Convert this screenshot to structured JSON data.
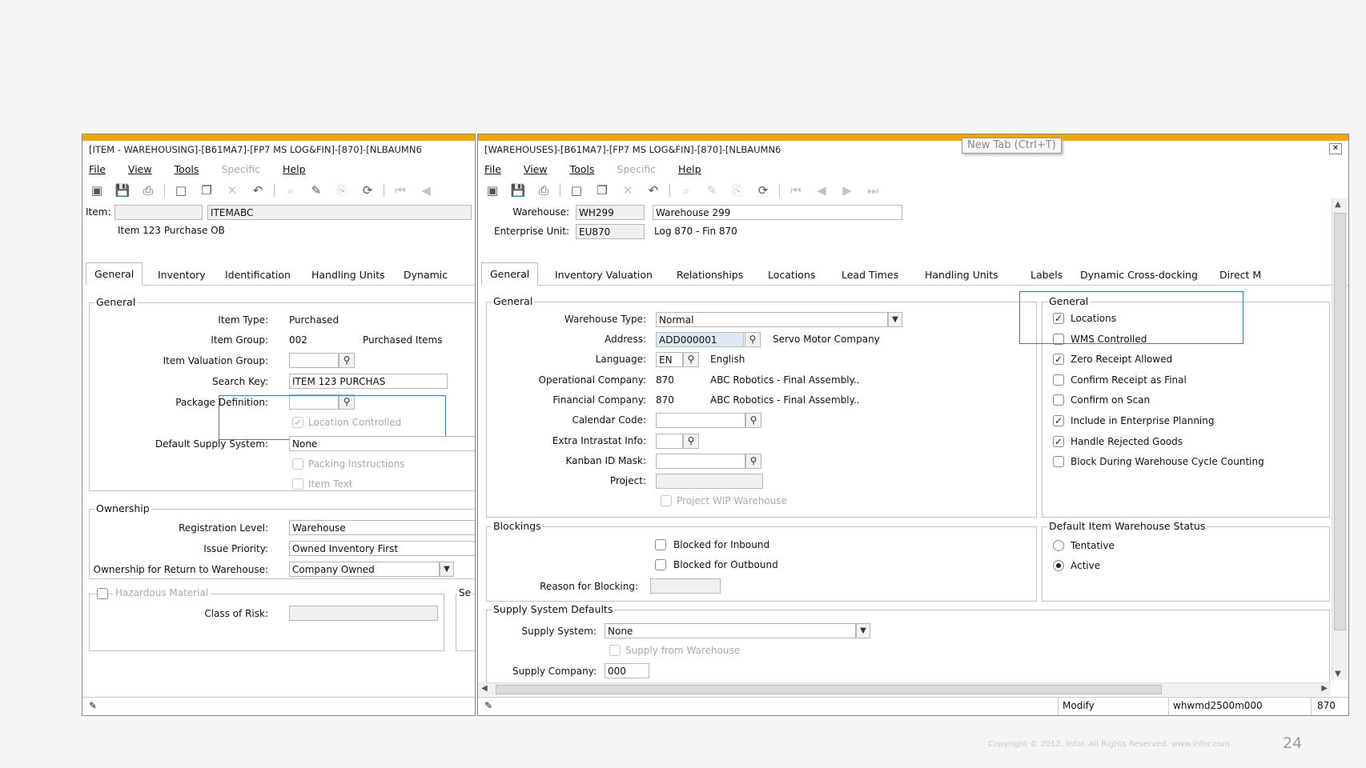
{
  "left": {
    "title": "[ITEM - WAREHOUSING]-[B61MA7]-[FP7 MS LOG&FIN]-[870]-[NLBAUMN6",
    "menu": [
      "File",
      "View",
      "Tools",
      "Specific",
      "Help"
    ],
    "header": {
      "item_label": "Item:",
      "item_code": "ITEMABC",
      "item_desc": "Item 123 Purchase OB"
    },
    "tabs": [
      "General",
      "Inventory",
      "Identification",
      "Handling Units",
      "Dynamic"
    ],
    "general": {
      "title": "General",
      "item_type_label": "Item Type:",
      "item_type": "Purchased",
      "item_group_label": "Item Group:",
      "item_group": "002",
      "item_group_desc": "Purchased Items",
      "valuation_label": "Item Valuation Group:",
      "valuation_value": "",
      "search_key_label": "Search Key:",
      "search_key": "ITEM 123 PURCHAS",
      "package_label": "Package Definition:",
      "package_value": "",
      "location_controlled": "Location Controlled",
      "supply_label": "Default Supply System:",
      "supply_value": "None",
      "packing": "Packing Instructions",
      "item_text": "Item Text"
    },
    "ownership": {
      "title": "Ownership",
      "reg_label": "Registration Level:",
      "reg_value": "Warehouse",
      "issue_label": "Issue Priority:",
      "issue_value": "Owned Inventory First",
      "return_label": "Ownership for Return to Warehouse:",
      "return_value": "Company Owned"
    },
    "hazard": {
      "label": "Hazardous Material",
      "class_label": "Class of Risk:",
      "class_value": "",
      "se": "Se"
    }
  },
  "right": {
    "title": "[WAREHOUSES]-[B61MA7]-[FP7 MS LOG&FIN]-[870]-[NLBAUMN6",
    "tooltip": "New Tab (Ctrl+T)",
    "menu": [
      "File",
      "View",
      "Tools",
      "Specific",
      "Help"
    ],
    "header": {
      "wh_label": "Warehouse:",
      "wh_code": "WH299",
      "wh_desc": "Warehouse 299",
      "eu_label": "Enterprise Unit:",
      "eu_code": "EU870",
      "eu_desc": "Log 870 - Fin 870"
    },
    "tabs": [
      "General",
      "Inventory Valuation",
      "Relationships",
      "Locations",
      "Lead Times",
      "Handling Units",
      "Labels",
      "Dynamic Cross-docking",
      "Direct M"
    ],
    "general": {
      "title": "General",
      "wt_label": "Warehouse Type:",
      "wt_value": "Normal",
      "addr_label": "Address:",
      "addr_value": "ADD000001",
      "addr_desc": "Servo Motor Company",
      "lang_label": "Language:",
      "lang_value": "EN",
      "lang_desc": "English",
      "opco_label": "Operational Company:",
      "opco_value": "870",
      "opco_desc": "ABC Robotics - Final Assembly..",
      "finco_label": "Financial Company:",
      "finco_value": "870",
      "finco_desc": "ABC Robotics - Final Assembly..",
      "cal_label": "Calendar Code:",
      "cal_value": "",
      "intra_label": "Extra Intrastat Info:",
      "intra_value": "",
      "kanban_label": "Kanban ID Mask:",
      "kanban_value": "",
      "project_label": "Project:",
      "project_value": "",
      "project_wip": "Project WIP Warehouse"
    },
    "checks": {
      "title": "General",
      "items": [
        {
          "label": "Locations",
          "checked": true
        },
        {
          "label": "WMS Controlled",
          "checked": false
        },
        {
          "label": "Zero Receipt Allowed",
          "checked": true
        },
        {
          "label": "Confirm Receipt as Final",
          "checked": false
        },
        {
          "label": "Confirm on Scan",
          "checked": false
        },
        {
          "label": "Include in Enterprise Planning",
          "checked": true
        },
        {
          "label": "Handle Rejected Goods",
          "checked": true
        },
        {
          "label": "Block During Warehouse Cycle Counting",
          "checked": false
        }
      ]
    },
    "blockings": {
      "title": "Blockings",
      "inbound": "Blocked for Inbound",
      "outbound": "Blocked for Outbound",
      "reason_label": "Reason for Blocking:",
      "reason_value": ""
    },
    "status_group": {
      "title": "Default Item Warehouse Status",
      "tentative": "Tentative",
      "active": "Active",
      "selected": "Active"
    },
    "supply": {
      "title": "Supply System Defaults",
      "system_label": "Supply System:",
      "system_value": "None",
      "from_wh": "Supply from Warehouse",
      "company_label": "Supply Company:",
      "company_value": "000"
    },
    "statusbar": {
      "mode": "Modify",
      "session": "whwmd2500m000",
      "company": "870"
    }
  },
  "footer": {
    "copyright": "Copyright © 2012. Infor. All Rights Reserved. www.infor.com",
    "page": "24"
  }
}
